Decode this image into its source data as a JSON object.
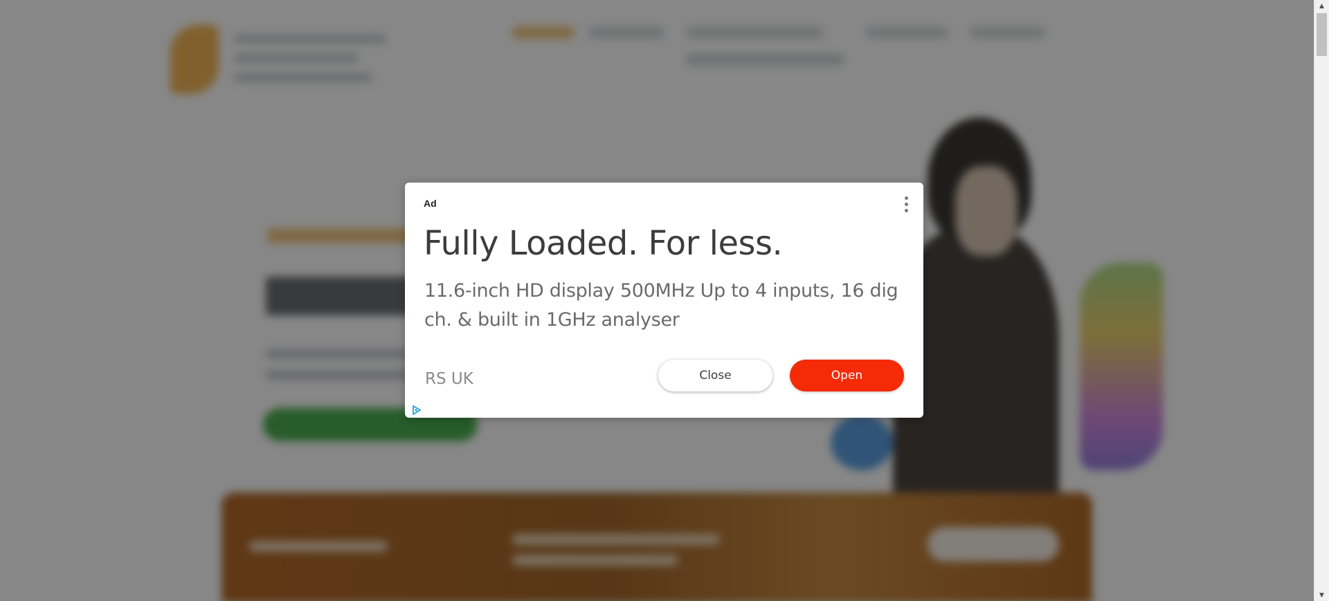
{
  "ad": {
    "badge": "Ad",
    "headline": "Fully Loaded. For less.",
    "body": "11.6-inch HD display 500MHz Up to 4 inputs, 16 dig ch. & built in 1GHz analyser",
    "advertiser": "RS UK",
    "close_label": "Close",
    "open_label": "Open",
    "menu_icon": "kebab-menu-icon",
    "adchoices_icon": "adchoices-icon"
  },
  "colors": {
    "open_button": "#f52a07",
    "adchoices": "#1fa3d6",
    "overlay": "rgba(0,0,0,0.47)"
  }
}
